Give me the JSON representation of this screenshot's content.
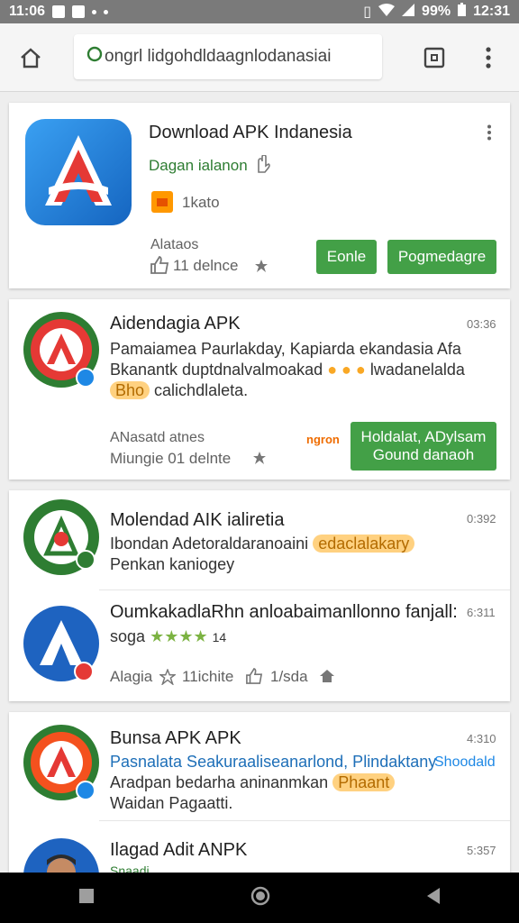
{
  "status_bar": {
    "time_left": "11:06",
    "battery": "99%",
    "time_right": "12:31"
  },
  "browser": {
    "url": "ongrl lidgohdldaagnlodanasiai"
  },
  "colors": {
    "accent_green": "#43a047",
    "icon_blue": "#1e88e5",
    "icon_red": "#e53935",
    "icon_green": "#2e7d32"
  },
  "featured": {
    "icon": "apk-logo-icon",
    "title": "Download APK Indanesia",
    "developer": "Dagan ialanon",
    "category": "1kato",
    "rating_label": "Alataos",
    "reviews": "11 delnce",
    "button_1": "Eonle",
    "button_2": "Pogmedagre"
  },
  "items": [
    {
      "title": "Aidendagia APK",
      "time": "03:36",
      "desc_1": "Pamaiamea Paurlakday, Kapiarda ekandasia Afa",
      "desc_2": "Bkanantk duptdnalvalmoakad",
      "desc_2b": "lwadanelalda",
      "desc_3_hl": "Bho",
      "desc_3": "calichdlaleta.",
      "meta_1": "ANasatd atnes",
      "meta_2": "Miungie 01 delnte",
      "tag": "ngron",
      "button_line_1": "Holdalat, ADylsam",
      "button_line_2": "Gound danaoh"
    },
    {
      "title": "Molendad AIK ialiretia",
      "time": "0:392",
      "desc_1": "Ibondan Adetoraldaranoaini",
      "desc_1_hl": "edaclalakary",
      "desc_2": "Penkan kaniogey"
    },
    {
      "title": "OumkakadlaRhn anloabaimanllonno fanjall:",
      "time": "6:311",
      "rating": "soga",
      "stars": "★★★★",
      "stars_num": "14",
      "meta_1": "Alagia",
      "meta_2": "11ichite",
      "meta_3": "1/sda"
    },
    {
      "title": "Bunsa APK APK",
      "time": "4:310",
      "desc_1": "Pasnalata Seakuraaliseanarlond, Plindaktany",
      "desc_1_right": "Shoodald",
      "desc_2": "Aradpan bedarha aninanmkan",
      "desc_2_hl": "Phaant",
      "desc_3": "Waidan Pagaatti."
    },
    {
      "title": "Ilagad Adit ANPK",
      "time": "5:357",
      "desc_1": "Snaadi"
    }
  ]
}
